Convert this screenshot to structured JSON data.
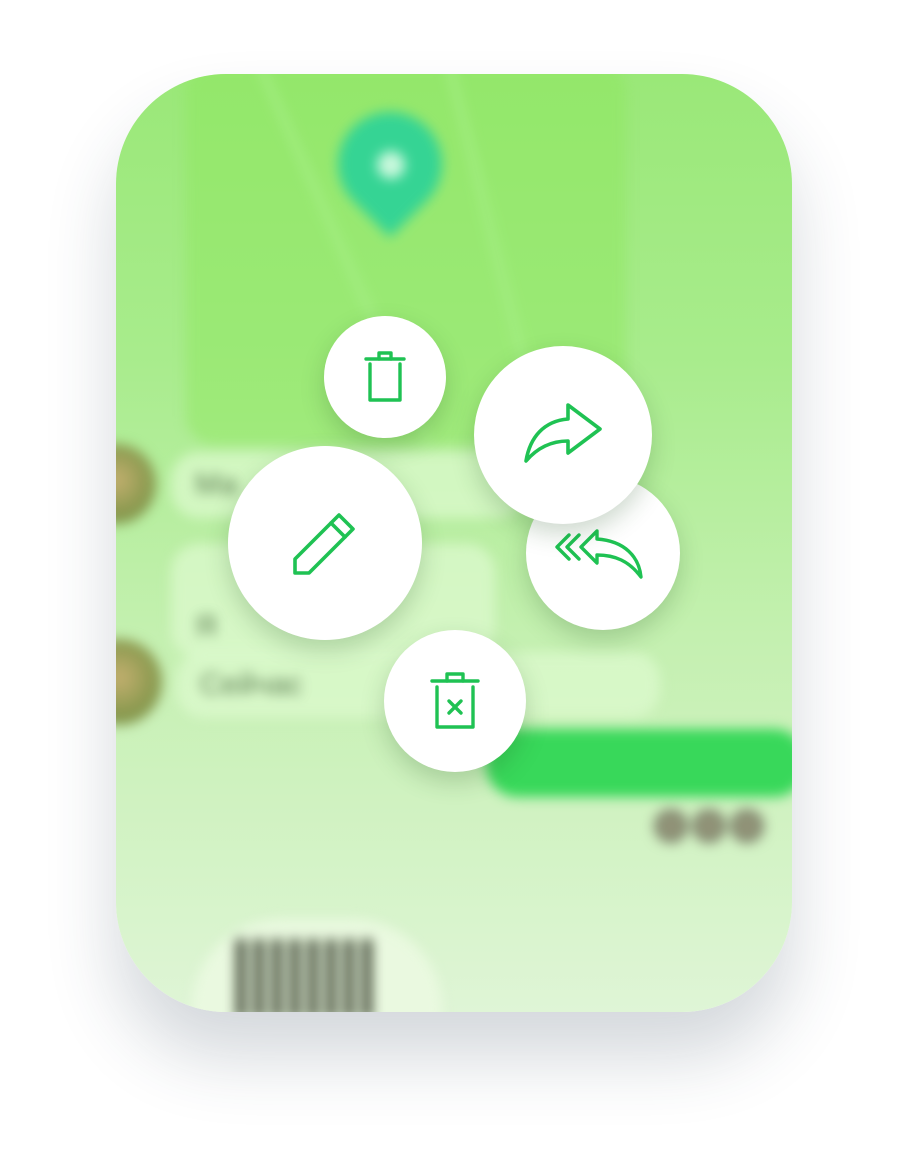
{
  "screen": {
    "background_blur": {
      "map_label": "",
      "messages": [
        {
          "text": "Ма"
        },
        {
          "text": "Я"
        },
        {
          "text": "Сейчас"
        }
      ],
      "own_message": "",
      "sender_name": ""
    }
  },
  "context_menu": {
    "accent_color": "#1fc253",
    "actions": [
      {
        "name": "delete",
        "icon": "trash-icon"
      },
      {
        "name": "forward",
        "icon": "forward-arrow-icon"
      },
      {
        "name": "edit",
        "icon": "pencil-icon"
      },
      {
        "name": "reply-all",
        "icon": "reply-all-icon"
      },
      {
        "name": "delete-for-everyone",
        "icon": "trash-x-icon"
      }
    ]
  }
}
